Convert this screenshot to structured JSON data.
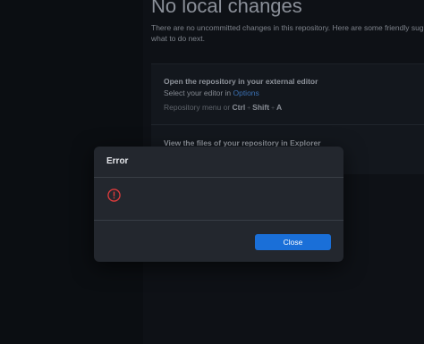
{
  "background": {
    "page_title": "No local changes",
    "description": "There are no uncommitted changes in this repository. Here are some friendly sugg what to do next.",
    "cards": [
      {
        "title": "Open the repository in your external editor",
        "text_prefix": "Select your editor in ",
        "link": "Options",
        "hint_prefix": "Repository menu or ",
        "shortcut": [
          "Ctrl",
          "Shift",
          "A"
        ]
      },
      {
        "title": "View the files of your repository in Explorer"
      }
    ]
  },
  "dialog": {
    "title": "Error",
    "icon": "error-circle-icon",
    "close_label": "Close",
    "colors": {
      "error": "#e03c3c",
      "primary_button": "#1a6fd8"
    }
  }
}
